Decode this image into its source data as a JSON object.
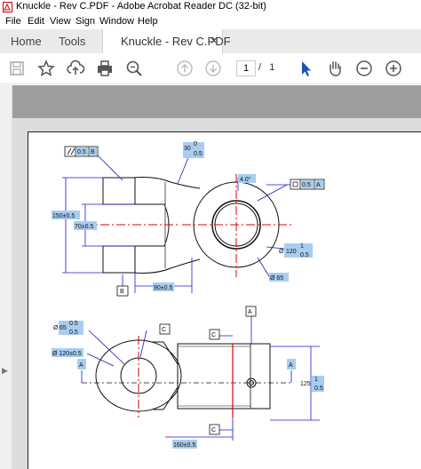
{
  "window": {
    "title": "Knuckle - Rev C.PDF - Adobe Acrobat Reader DC (32-bit)"
  },
  "menu": {
    "items": [
      "File",
      "Edit",
      "View",
      "Sign",
      "Window",
      "Help"
    ]
  },
  "tabs": {
    "home": "Home",
    "tools": "Tools",
    "document": "Knuckle - Rev C.PDF",
    "close": "×"
  },
  "toolbar": {
    "page_current": "1",
    "page_separator": "/",
    "page_total": "1"
  },
  "icons": [
    "save-icon",
    "bookmark-star-icon",
    "upload-cloud-icon",
    "print-icon",
    "search-zoom-icon",
    "page-up-icon",
    "page-down-icon",
    "select-cursor-icon",
    "hand-icon",
    "zoom-out-icon",
    "zoom-in-icon"
  ],
  "drawing": {
    "top_view": {
      "flatness": "0.5",
      "flatness_datum": "B",
      "angle": "30",
      "angle_tol_upper": "0",
      "angle_tol_lower": "0.5",
      "chamfer": "4.0°",
      "concentricity": "0.5",
      "concentricity_datum": "A",
      "width_outer": "150±0.5",
      "width_inner": "70±0.5",
      "hole_dia_prefix": "Ø",
      "hole_dia": "120",
      "hole_dia_tol_upper": "1",
      "hole_dia_tol_lower": "0.5",
      "bore_dia": "Ø 65",
      "datum_b": "B",
      "length": "90±0.5"
    },
    "front_view": {
      "pin_dia_prefix": "Ø",
      "pin_dia": "65",
      "pin_dia_tol_upper": "0.5",
      "pin_dia_tol_lower": "0.5",
      "boss_dia": "Ø 120±0.5",
      "datum_c_top": "C",
      "datum_c_right": "C",
      "datum_c_bottom": "C",
      "datum_a_top": "A",
      "section_a_left": "A",
      "section_a_right": "A",
      "height": "125",
      "height_tol_upper": "1",
      "height_tol_lower": "0.5",
      "length": "160±0.5"
    }
  }
}
